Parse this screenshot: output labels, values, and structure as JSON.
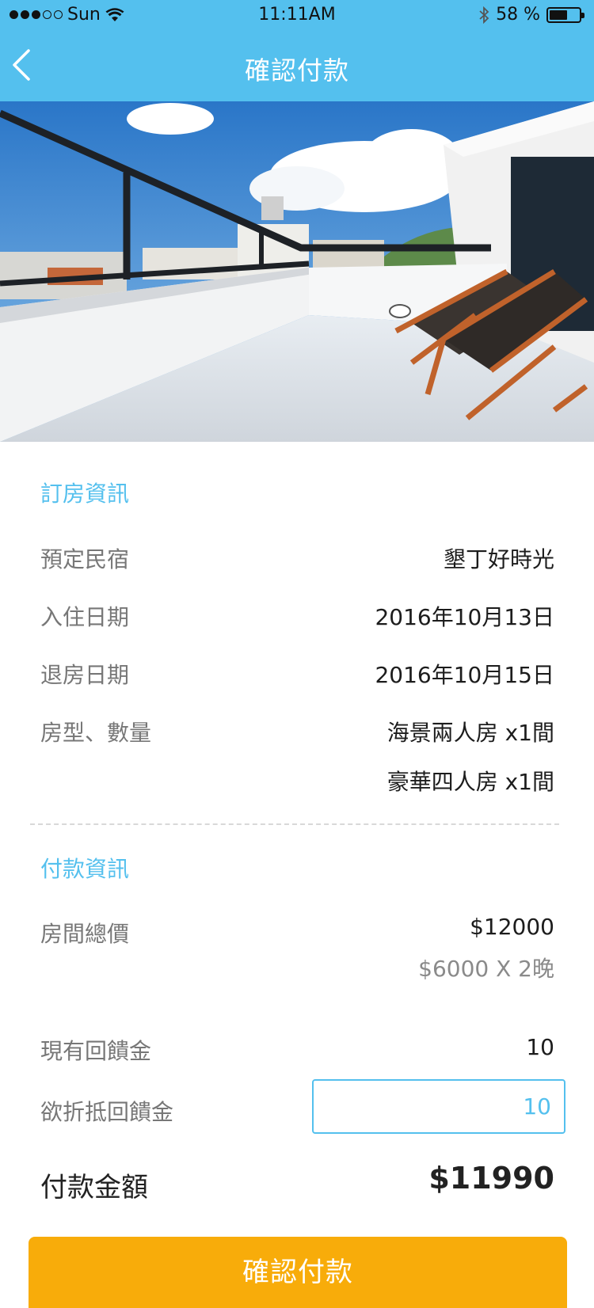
{
  "status_bar": {
    "carrier": "Sun",
    "time": "11:11AM",
    "battery_percent": "58 %",
    "battery_level": 0.58
  },
  "nav": {
    "title": "確認付款",
    "back_icon": "chevron-left-icon"
  },
  "booking_info": {
    "section_title": "訂房資訊",
    "rows": [
      {
        "label": "預定民宿",
        "value": "墾丁好時光"
      },
      {
        "label": "入住日期",
        "value": "2016年10月13日"
      },
      {
        "label": "退房日期",
        "value": "2016年10月15日"
      },
      {
        "label": "房型、數量",
        "values": [
          "海景兩人房 x1間",
          "豪華四人房 x1間"
        ]
      }
    ]
  },
  "payment_info": {
    "section_title": "付款資訊",
    "room_total_label": "房間總價",
    "room_total_value": "$12000",
    "room_total_detail": "$6000 X 2晚",
    "rebate_label": "現有回饋金",
    "rebate_value": "10",
    "deduct_label": "欲折抵回饋金",
    "deduct_input_value": "10"
  },
  "total": {
    "label": "付款金額",
    "value": "$11990"
  },
  "confirm_button": {
    "label": "確認付款"
  },
  "colors": {
    "header": "#54c0ee",
    "accent": "#54c0ee",
    "button": "#f8ac0a"
  }
}
